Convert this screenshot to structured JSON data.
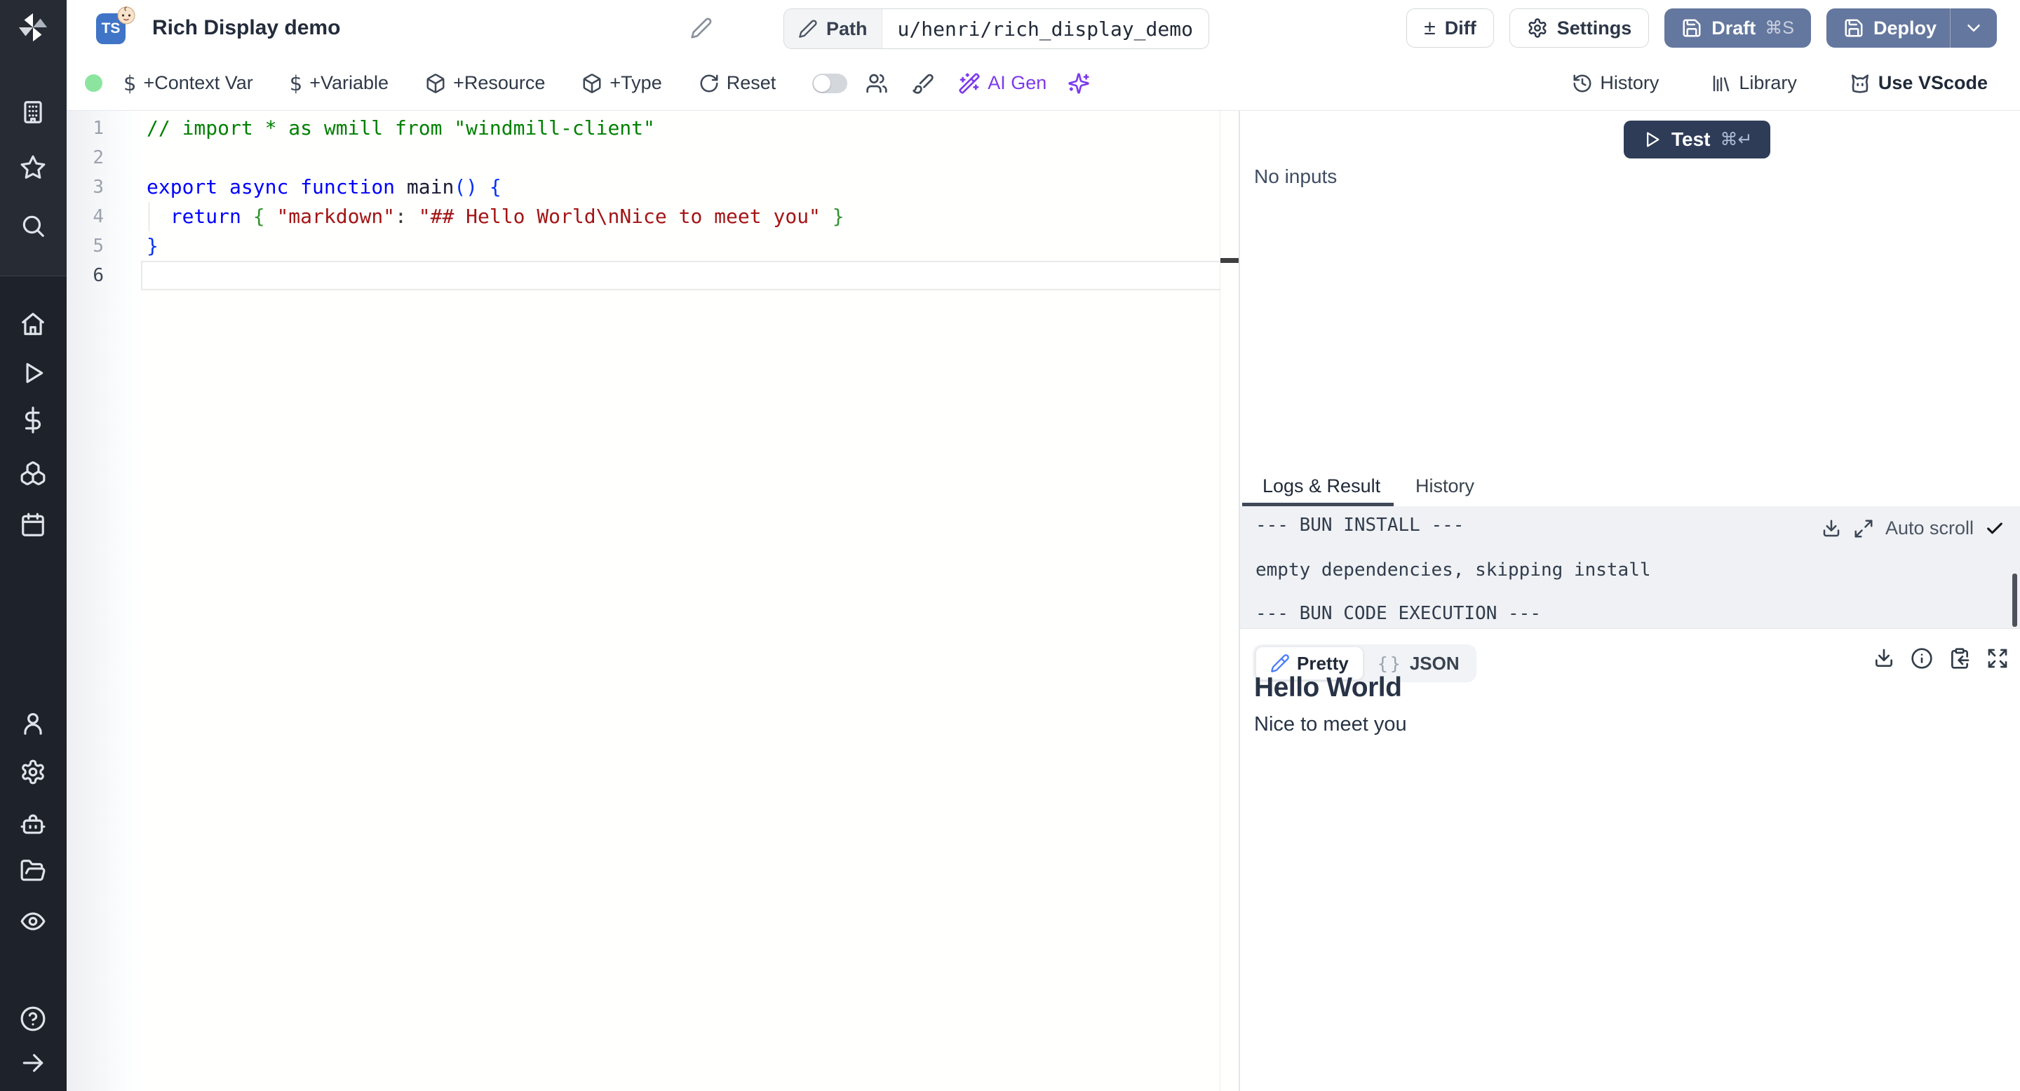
{
  "app": {
    "name": "Windmill script editor"
  },
  "header": {
    "badge": "TS",
    "title": "Rich Display demo",
    "path_label": "Path",
    "path_value": "u/henri/rich_display_demo",
    "diff_label": "Diff",
    "settings_label": "Settings",
    "draft_label": "Draft",
    "draft_kbd": "⌘S",
    "deploy_label": "Deploy"
  },
  "toolbar": {
    "context_var": "+Context Var",
    "variable": "+Variable",
    "resource": "+Resource",
    "type": "+Type",
    "reset": "Reset",
    "ai_gen": "AI Gen",
    "history": "History",
    "library": "Library",
    "vscode": "Use VScode"
  },
  "icons": {
    "diff": "±",
    "dollar": "$",
    "check": "✓",
    "braces": "{}"
  },
  "editor": {
    "active_line": "6",
    "lines": [
      {
        "no": "1",
        "tokens": [
          [
            "cmt",
            "// import * as wmill from \"windmill-client\""
          ]
        ]
      },
      {
        "no": "2",
        "tokens": []
      },
      {
        "no": "3",
        "tokens": [
          [
            "kw",
            "export"
          ],
          [
            "pln",
            " "
          ],
          [
            "kw",
            "async"
          ],
          [
            "pln",
            " "
          ],
          [
            "kw",
            "function"
          ],
          [
            "pln",
            " "
          ],
          [
            "id",
            "main"
          ],
          [
            "b1",
            "()"
          ],
          [
            "pln",
            " "
          ],
          [
            "b1",
            "{"
          ]
        ]
      },
      {
        "no": "4",
        "tokens": [
          [
            "pln",
            "  "
          ],
          [
            "kw",
            "return"
          ],
          [
            "pln",
            " "
          ],
          [
            "b2",
            "{"
          ],
          [
            "pln",
            " "
          ],
          [
            "str",
            "\"markdown\""
          ],
          [
            "pln",
            ": "
          ],
          [
            "str",
            "\"## Hello World\\nNice to meet you\""
          ],
          [
            "pln",
            " "
          ],
          [
            "b2",
            "}"
          ]
        ]
      },
      {
        "no": "5",
        "tokens": [
          [
            "b1",
            "}"
          ]
        ]
      },
      {
        "no": "6",
        "tokens": []
      }
    ]
  },
  "run": {
    "test_label": "Test",
    "test_kbd": "⌘↵",
    "no_inputs": "No inputs"
  },
  "output": {
    "tabs": [
      "Logs & Result",
      "History"
    ],
    "logs": [
      "--- BUN INSTALL ---",
      "empty dependencies, skipping install",
      "--- BUN CODE EXECUTION ---"
    ],
    "auto_scroll": "Auto scroll",
    "pretty_label": "Pretty",
    "json_label": "JSON",
    "result_title": "Hello World",
    "result_body": "Nice to meet you"
  },
  "colors": {
    "sidebar_bg": "#1e232b",
    "accent_purple": "#7c3aed",
    "slate_button": "#64779e",
    "test_button": "#2e3c58",
    "status_green": "#8ce59f",
    "logs_bg": "#eff1f4",
    "code_comment": "#008000",
    "code_keyword": "#0000ff",
    "code_string": "#a31515"
  }
}
